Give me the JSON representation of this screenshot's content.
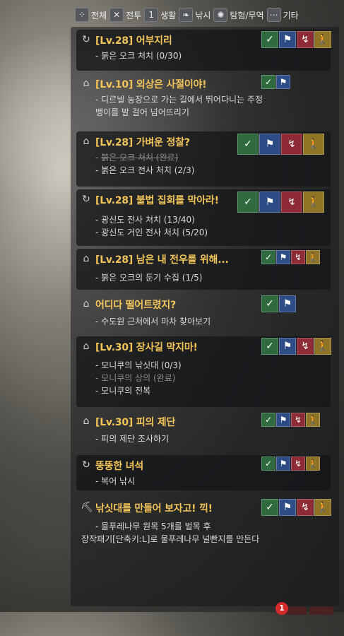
{
  "filters": [
    {
      "icon": "all-icon",
      "glyph": "⁘",
      "label": "전체"
    },
    {
      "icon": "combat-icon",
      "glyph": "✕",
      "label": "전투"
    },
    {
      "icon": "life-icon",
      "glyph": "1",
      "label": "생활"
    },
    {
      "icon": "fishing-icon",
      "glyph": "❧",
      "label": "낚시"
    },
    {
      "icon": "explore-trade-icon",
      "glyph": "✺",
      "label": "탐험/무역"
    },
    {
      "icon": "etc-icon",
      "glyph": "⋯",
      "label": "기타"
    }
  ],
  "quests": [
    {
      "title": "[Lv.28] 어부지리",
      "icon": "repeat-icon",
      "tasks": [
        {
          "text": "붉은 오크 처치 (0/30)",
          "done": false
        }
      ]
    },
    {
      "title": "[Lv.10] 외상은 사절이야!",
      "icon": "house-icon",
      "desc": [
        "- 디르넬 농장으로 가는 길에서 뛰어다니는 주정",
        "뱅이를 발 걸어 넘어뜨리기"
      ]
    },
    {
      "title": "[Lv.28] 가벼운 정찰?",
      "icon": "house-icon",
      "tasks": [
        {
          "text": "붉은 오크 처치 (완료)",
          "done": true
        },
        {
          "text": "붉은 오크 전사 처치 (2/3)",
          "done": false
        }
      ]
    },
    {
      "title": "[Lv.28] 불법 집회를 막아라!",
      "icon": "repeat-icon",
      "tasks": [
        {
          "text": "광신도 전사 처치 (13/40)",
          "done": false
        },
        {
          "text": "광신도 거인 전사 처치 (5/20)",
          "done": false
        }
      ]
    },
    {
      "title": "[Lv.28] 남은 내 전우를 위해...",
      "icon": "house-icon",
      "tasks": [
        {
          "text": "붉은 오크의 둔기 수집 (1/5)",
          "done": false
        }
      ]
    },
    {
      "title": "어디다 떨어트렸지?",
      "icon": "house-icon",
      "tasks": [
        {
          "text": "수도원 근처에서 마차 찾아보기",
          "done": false
        }
      ]
    },
    {
      "title": "[Lv.30] 장사길 막지마!",
      "icon": "house-icon",
      "tasks": [
        {
          "text": "모니쿠의 낚싯대 (0/3)",
          "done": false
        },
        {
          "text": "모니쿠의 상의 (완료)",
          "done": true
        },
        {
          "text": "모니쿠의 전복",
          "done": false
        }
      ]
    },
    {
      "title": "[Lv.30] 피의 제단",
      "icon": "house-icon",
      "tasks": [
        {
          "text": "피의 제단 조사하기",
          "done": false
        }
      ]
    },
    {
      "title": "뚱뚱한 녀석",
      "icon": "repeat-icon",
      "tasks": [
        {
          "text": "복어 낚시",
          "done": false
        }
      ]
    },
    {
      "title": "낚싯대를 만들어 보자고! 끽!",
      "icon": "pickaxe-icon",
      "desc": [
        "- 물푸레나무 원목 5개를 벌목 후",
        "장작패기[단축키:L]로 물푸레나무 널빤지를 만든다"
      ]
    }
  ],
  "notification_count": "1",
  "colors": {
    "title": "#f2c55a",
    "check": "#2f6b3e",
    "flag": "#2e4d86",
    "move": "#8f2b36",
    "walk": "#8f7426"
  }
}
